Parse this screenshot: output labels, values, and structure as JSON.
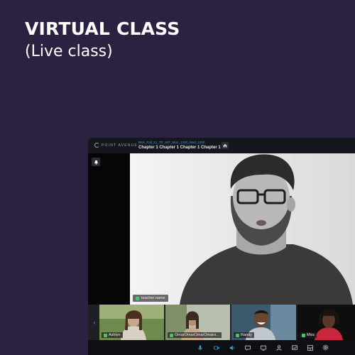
{
  "hero": {
    "title": "VIRTUAL CLASS",
    "subtitle": "(Live class)"
  },
  "app": {
    "brand": "POINT AVENUE",
    "class_code": "BKK_Fall_21_TP_S4T_Mon_1330_Wed_1300",
    "class_title": "Chapter 1 Chapter 1 Chapter 1 Chapter 1",
    "teacher_name": "teacher name"
  },
  "participants": [
    {
      "name": "Ashlyn"
    },
    {
      "name": "OmarOmarOmarOmaro..."
    },
    {
      "name": "Randy"
    },
    {
      "name": "Mira"
    }
  ],
  "icons": {
    "home": "home-icon",
    "side_tool": "bell-icon",
    "controls": [
      "microphone-icon",
      "camera-icon",
      "speaker-icon",
      "chat-icon",
      "screen-share-icon",
      "participants-icon",
      "whiteboard-icon",
      "layout-icon",
      "settings-icon"
    ]
  },
  "colors": {
    "background": "#2d2142",
    "accent_blue": "#3f9fe0",
    "mic_active": "#4cc36a"
  }
}
